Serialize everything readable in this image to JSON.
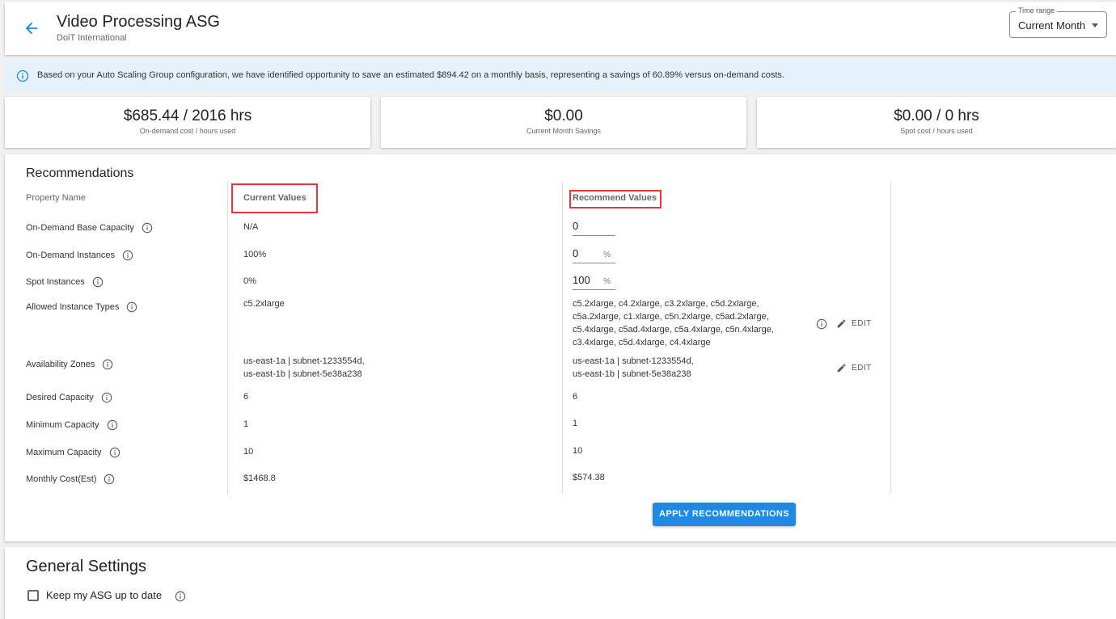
{
  "header": {
    "title": "Video Processing ASG",
    "subtitle": "DoiT International",
    "time_range": {
      "label": "Time range",
      "value": "Current Month"
    }
  },
  "alert": {
    "text": "Based on your Auto Scaling Group configuration, we have identified opportunity to save an estimated $894.42 on a monthly basis, representing a savings of 60.89% versus on-demand costs.",
    "color": "#e5f2fb"
  },
  "cards": [
    {
      "value": "$685.44 / 2016 hrs",
      "label": "On-demand cost / hours used"
    },
    {
      "value": "$0.00",
      "label": "Current Month Savings"
    },
    {
      "value": "$0.00 / 0 hrs",
      "label": "Spot cost / hours used"
    }
  ],
  "recommendations": {
    "title": "Recommendations",
    "columns": {
      "property": "Property Name",
      "current": "Current Values",
      "recommend": "Recommend Values"
    },
    "rows": {
      "base_capacity": {
        "name": "On-Demand Base Capacity",
        "current": "N/A",
        "recommend": "0"
      },
      "od_instances": {
        "name": "On-Demand Instances",
        "current": "100%",
        "recommend": "0",
        "unit": "%"
      },
      "spot_instances": {
        "name": "Spot Instances",
        "current": "0%",
        "recommend": "100",
        "unit": "%"
      },
      "instance_types": {
        "name": "Allowed Instance Types",
        "current": "c5.2xlarge",
        "recommend_lines": [
          "c5.2xlarge, c4.2xlarge, c3.2xlarge, c5d.2xlarge,",
          "c5a.2xlarge, c1.xlarge, c5n.2xlarge, c5ad.2xlarge,",
          "c5.4xlarge, c5ad.4xlarge, c5a.4xlarge, c5n.4xlarge,",
          "c3.4xlarge, c5d.4xlarge, c4.4xlarge"
        ],
        "edit": "EDIT"
      },
      "availability_zones": {
        "name": "Availability Zones",
        "current_lines": [
          "us-east-1a | subnet-1233554d,",
          "us-east-1b | subnet-5e38a238"
        ],
        "recommend_lines": [
          "us-east-1a | subnet-1233554d,",
          "us-east-1b | subnet-5e38a238"
        ],
        "edit": "EDIT"
      },
      "desired_capacity": {
        "name": "Desired Capacity",
        "current": "6",
        "recommend": "6"
      },
      "min_capacity": {
        "name": "Minimum Capacity",
        "current": "1",
        "recommend": "1"
      },
      "max_capacity": {
        "name": "Maximum Capacity",
        "current": "10",
        "recommend": "10"
      },
      "monthly_cost": {
        "name": "Monthly Cost(Est)",
        "current": "$1468.8",
        "recommend": "$574.38"
      }
    },
    "apply_label": "APPLY RECOMMENDATIONS",
    "accent": "#1e88e5",
    "highlight": "#e5383b"
  },
  "general_settings": {
    "title": "General Settings",
    "options": [
      {
        "label": "Keep my ASG up to date",
        "checked": false
      }
    ]
  }
}
